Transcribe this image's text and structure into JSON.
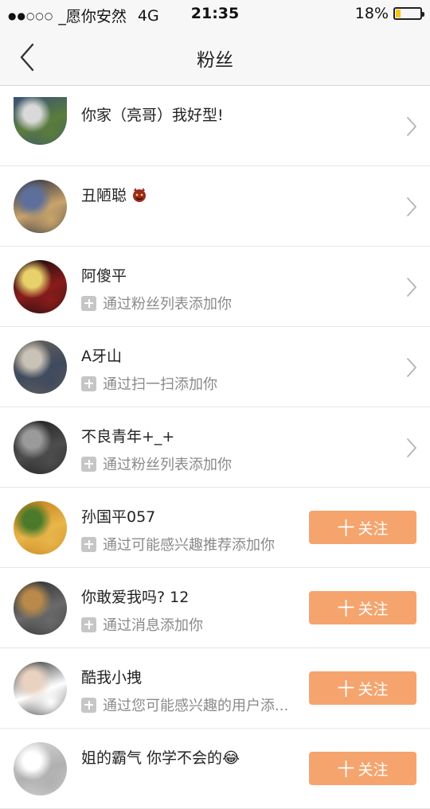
{
  "status_bar": {
    "signal_dots": "●●○○○",
    "carrier": "_愿你安然",
    "network": "4G",
    "time": "21:35",
    "battery_percent": "18%",
    "battery_level": 0.18
  },
  "nav": {
    "back_icon": "chevron-left-icon",
    "title": "粉丝"
  },
  "fans": [
    {
      "name": "你家（亮哥）我好型!",
      "source": "",
      "action": "chevron",
      "avatar_colors": [
        "#3a4f78",
        "#d9d9d9",
        "#5a7d3c"
      ]
    },
    {
      "name": "丑陋聪",
      "emoji": "devil-face-icon",
      "source": "",
      "action": "chevron",
      "avatar_colors": [
        "#1e2740",
        "#5d6f9a",
        "#c9a46a"
      ]
    },
    {
      "name": "阿傻平",
      "source": "通过粉丝列表添加你",
      "action": "chevron",
      "avatar_colors": [
        "#0b0b0b",
        "#e8d16b",
        "#8a1c1c"
      ]
    },
    {
      "name": "A牙山",
      "source": "通过扫一扫添加你",
      "action": "chevron",
      "avatar_colors": [
        "#6d6458",
        "#c9c2b6",
        "#3e4a5e"
      ]
    },
    {
      "name": "不良青年+_+",
      "source": "通过粉丝列表添加你",
      "action": "chevron",
      "avatar_colors": [
        "#1a1a1a",
        "#9a9a9a",
        "#4d4d4d"
      ]
    },
    {
      "name": "孙国平057",
      "source": "通过可能感兴趣推荐添加你",
      "action": "follow",
      "avatar_colors": [
        "#c47a18",
        "#4a7a2a",
        "#e8b64a"
      ]
    },
    {
      "name": "你敢爱我吗? 12",
      "source": "通过消息添加你",
      "action": "follow",
      "avatar_colors": [
        "#2a2a2a",
        "#b98a4a",
        "#6a6a6a"
      ]
    },
    {
      "name": "酷我小拽",
      "source": "通过您可能感兴趣的用户添...",
      "action": "follow",
      "avatar_colors": [
        "#2b2b2b",
        "#e9d2c0",
        "#ffffff"
      ]
    },
    {
      "name": "姐的霸气 你学不会的😂",
      "source": "",
      "action": "follow",
      "avatar_colors": [
        "#d8d8d8",
        "#ffffff",
        "#b0b0b0"
      ]
    }
  ],
  "follow_label": "关注",
  "follow_plus": "十",
  "accent_color": "#f5a46d"
}
